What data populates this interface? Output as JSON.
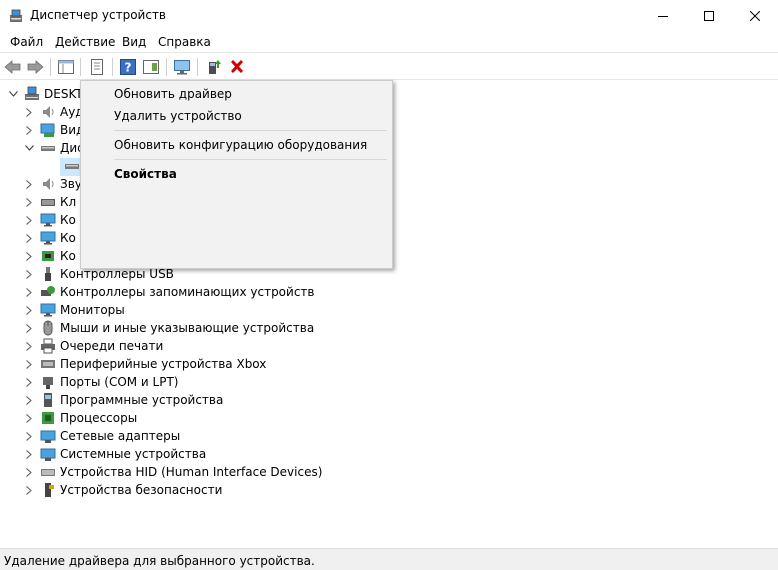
{
  "window": {
    "title": "Диспетчер устройств"
  },
  "menu": [
    "Файл",
    "Действие",
    "Вид",
    "Справка"
  ],
  "tree": {
    "root": "DESKTOP-DBJ51NG",
    "items": [
      {
        "label": "Аудиовходы и аудиовыходы",
        "icon": "speaker-icon"
      },
      {
        "label": "Видеоадаптеры",
        "icon": "display-adapter-icon"
      },
      {
        "label": "Дисковые устройства",
        "icon": "disk-drive-icon",
        "expanded": true
      },
      {
        "label": "",
        "icon": "disk-icon",
        "child": true
      },
      {
        "label": "Зву",
        "icon": "speaker-icon"
      },
      {
        "label": "Кл",
        "icon": "keyboard-icon"
      },
      {
        "label": "Ко",
        "icon": "computer-icon"
      },
      {
        "label": "Ко",
        "icon": "monitor-icon"
      },
      {
        "label": "Ко",
        "icon": "chip-icon"
      },
      {
        "label": "Контроллеры USB",
        "icon": "usb-icon"
      },
      {
        "label": "Контроллеры запоминающих устройств",
        "icon": "storage-controller-icon"
      },
      {
        "label": "Мониторы",
        "icon": "monitor-icon"
      },
      {
        "label": "Мыши и иные указывающие устройства",
        "icon": "mouse-icon"
      },
      {
        "label": "Очереди печати",
        "icon": "printer-icon"
      },
      {
        "label": "Периферийные устройства Xbox",
        "icon": "peripheral-icon"
      },
      {
        "label": "Порты (COM и LPT)",
        "icon": "port-icon"
      },
      {
        "label": "Программные устройства",
        "icon": "software-device-icon"
      },
      {
        "label": "Процессоры",
        "icon": "processor-icon"
      },
      {
        "label": "Сетевые адаптеры",
        "icon": "network-icon"
      },
      {
        "label": "Системные устройства",
        "icon": "system-device-icon"
      },
      {
        "label": "Устройства HID (Human Interface Devices)",
        "icon": "hid-icon"
      },
      {
        "label": "Устройства безопасности",
        "icon": "security-icon"
      }
    ]
  },
  "context_menu": {
    "update_driver": "Обновить драйвер",
    "uninstall_device": "Удалить устройство",
    "scan_hardware": "Обновить конфигурацию оборудования",
    "properties": "Свойства"
  },
  "statusbar": {
    "text": "Удаление драйвера для выбранного устройства."
  },
  "colors": {
    "selection": "#cce8ff",
    "delete": "#d40000",
    "accent": "#0078d7"
  }
}
